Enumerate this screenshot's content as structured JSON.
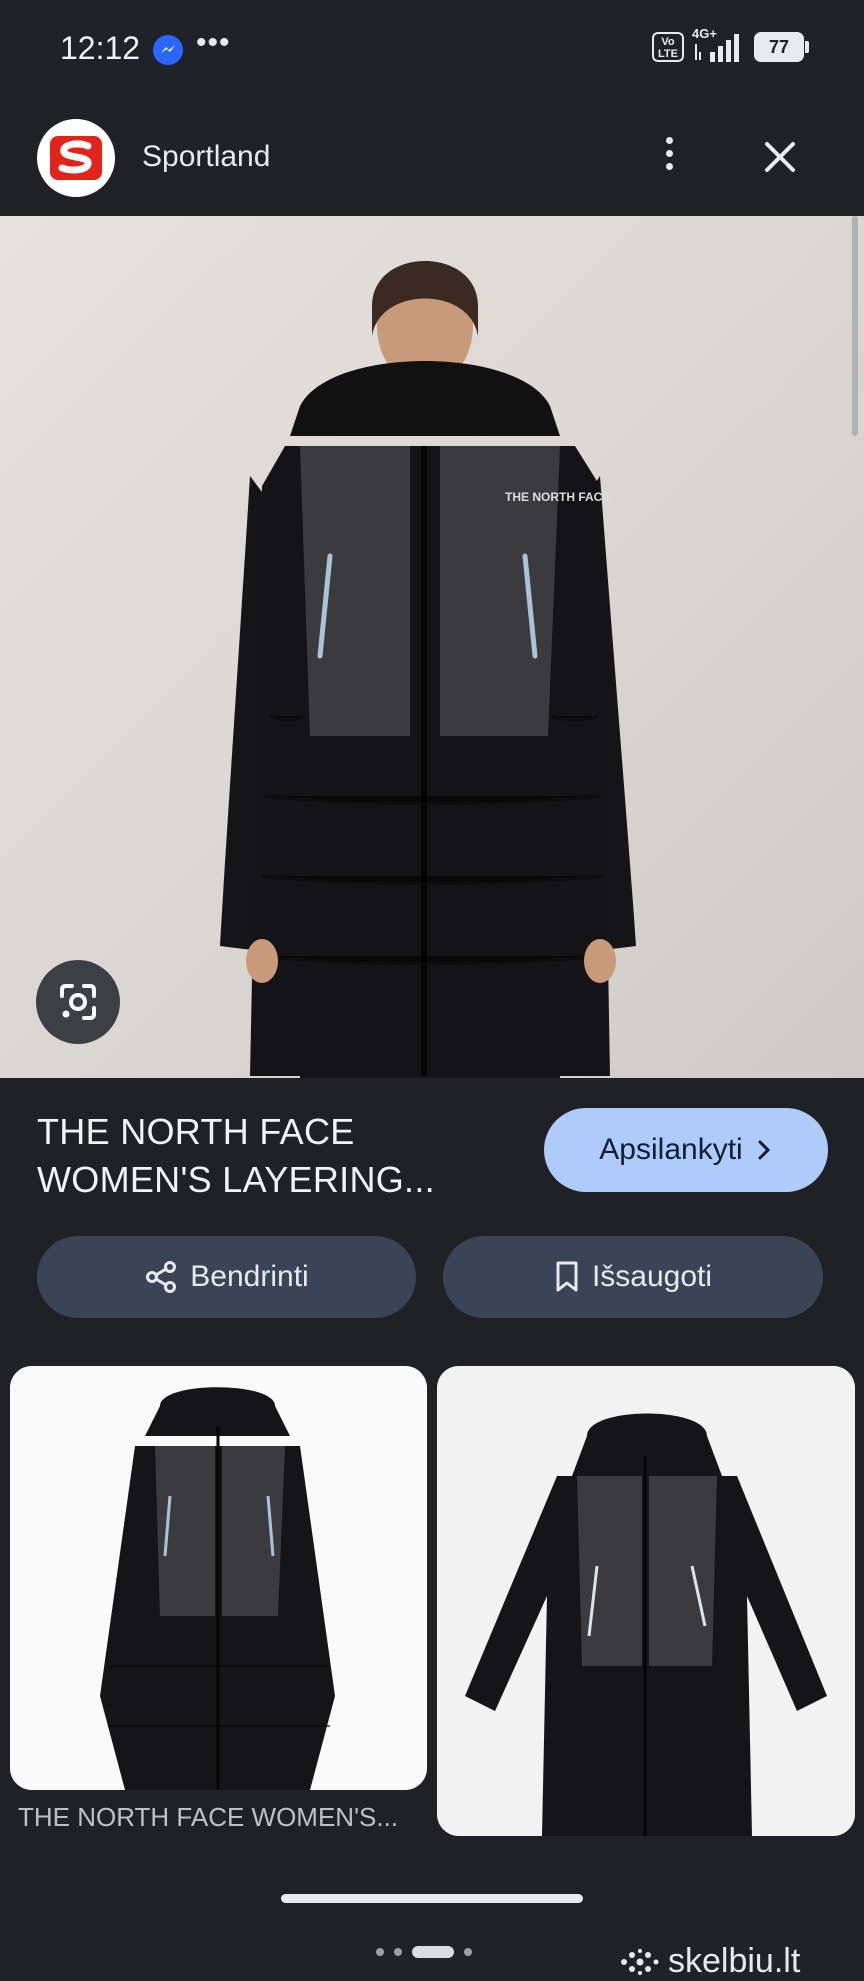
{
  "status_bar": {
    "time": "12:12",
    "more": "•••",
    "volte": "Vo\nLTE",
    "network": "4G+",
    "battery": "77"
  },
  "header": {
    "site_name": "Sportland"
  },
  "product": {
    "title": "THE NORTH FACE WOMEN'S LAYERING...",
    "visit_label": "Apsilankyti",
    "share_label": "Bendrinti",
    "save_label": "Išsaugoti"
  },
  "related": {
    "caption": "THE NORTH FACE WOMEN'S..."
  },
  "watermark": "skelbiu.lt",
  "icons": [
    "messenger-icon",
    "signal-icon",
    "battery-icon",
    "sportland-logo",
    "more-vert-icon",
    "close-icon",
    "google-lens-icon",
    "chevron-right-icon",
    "share-icon",
    "bookmark-icon"
  ],
  "colors": {
    "background": "#202124",
    "visit_button": "#aecbfa",
    "pill_button": "#394457"
  }
}
